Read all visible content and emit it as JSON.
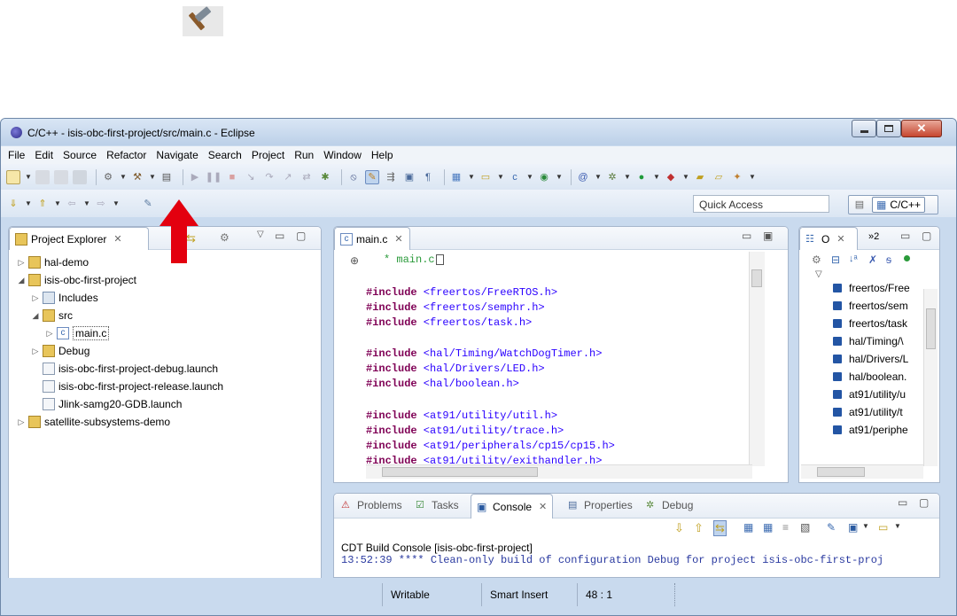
{
  "window": {
    "title": "C/C++ - isis-obc-first-project/src/main.c - Eclipse"
  },
  "menu": [
    "File",
    "Edit",
    "Source",
    "Refactor",
    "Navigate",
    "Search",
    "Project",
    "Run",
    "Window",
    "Help"
  ],
  "quick_access": "Quick Access",
  "perspective": "C/C++",
  "project_explorer": {
    "tab": "Project Explorer",
    "items": [
      {
        "label": "hal-demo",
        "depth": 0,
        "twisty": "▷"
      },
      {
        "label": "isis-obc-first-project",
        "depth": 0,
        "twisty": "◢"
      },
      {
        "label": "Includes",
        "depth": 1,
        "twisty": "▷"
      },
      {
        "label": "src",
        "depth": 1,
        "twisty": "◢"
      },
      {
        "label": "main.c",
        "depth": 2,
        "twisty": "▷"
      },
      {
        "label": "Debug",
        "depth": 1,
        "twisty": "▷"
      },
      {
        "label": "isis-obc-first-project-debug.launch",
        "depth": 1,
        "twisty": ""
      },
      {
        "label": "isis-obc-first-project-release.launch",
        "depth": 1,
        "twisty": ""
      },
      {
        "label": "Jlink-samg20-GDB.launch",
        "depth": 1,
        "twisty": ""
      },
      {
        "label": "satellite-subsystems-demo",
        "depth": 0,
        "twisty": "▷"
      }
    ]
  },
  "editor": {
    "tab": "main.c",
    "lines": [
      {
        "kw": "",
        "txt": "* main.c"
      },
      {
        "kw": "#include",
        "txt": " <freertos/FreeRTOS.h>"
      },
      {
        "kw": "#include",
        "txt": " <freertos/semphr.h>"
      },
      {
        "kw": "#include",
        "txt": " <freertos/task.h>"
      },
      {
        "kw": "#include",
        "txt": " <hal/Timing/WatchDogTimer.h>"
      },
      {
        "kw": "#include",
        "txt": " <hal/Drivers/LED.h>"
      },
      {
        "kw": "#include",
        "txt": " <hal/boolean.h>"
      },
      {
        "kw": "#include",
        "txt": " <at91/utility/util.h>"
      },
      {
        "kw": "#include",
        "txt": " <at91/utility/trace.h>"
      },
      {
        "kw": "#include",
        "txt": " <at91/peripherals/cp15/cp15.h>"
      },
      {
        "kw": "#include",
        "txt": " <at91/utility/exithandler.h>"
      }
    ]
  },
  "outline": {
    "tab": "O",
    "overflow": "»2",
    "items": [
      "freertos/Free",
      "freertos/sem",
      "freertos/task",
      "hal/Timing/\\",
      "hal/Drivers/L",
      "hal/boolean.",
      "at91/utility/u",
      "at91/utility/t",
      "at91/periphe"
    ]
  },
  "bottom": {
    "tabs": [
      "Problems",
      "Tasks",
      "Console",
      "Properties",
      "Debug"
    ],
    "console_title": "CDT Build Console [isis-obc-first-project]",
    "console_line": "13:52:39 **** Clean-only build of configuration Debug for project isis-obc-first-proj"
  },
  "status": {
    "writable": "Writable",
    "insert": "Smart Insert",
    "position": "48 : 1"
  },
  "colors": {
    "arrow": "#e3000f",
    "keyword": "#7f0055",
    "string": "#2a00ff"
  }
}
